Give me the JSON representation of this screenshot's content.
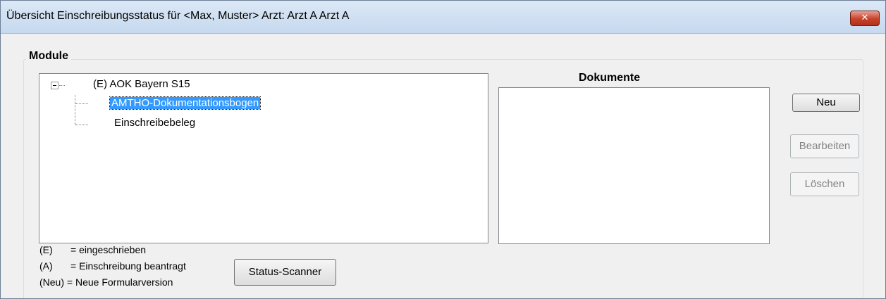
{
  "window": {
    "title": "Übersicht Einschreibungsstatus für <Max, Muster> Arzt: Arzt A Arzt A",
    "close_label": "✕"
  },
  "module_group": {
    "title": "Module"
  },
  "tree": {
    "root_label": "(E) AOK Bayern S15",
    "children": [
      {
        "label": "AMTHO-Dokumentationsbogen",
        "selected": true
      },
      {
        "label": "Einschreibebeleg",
        "selected": false
      }
    ]
  },
  "documents": {
    "title": "Dokumente"
  },
  "buttons": {
    "new_label": "Neu",
    "edit_label": "Bearbeiten",
    "delete_label": "Löschen",
    "status_scanner_label": "Status-Scanner"
  },
  "legend": [
    {
      "key": "(E)",
      "text": "= eingeschrieben"
    },
    {
      "key": "(A)",
      "text": "= Einschreibung beantragt"
    },
    {
      "key": "(Neu)",
      "text": "= Neue Formularversion"
    }
  ],
  "colors": {
    "selection": "#3399ff",
    "close_button": "#c6412a"
  }
}
